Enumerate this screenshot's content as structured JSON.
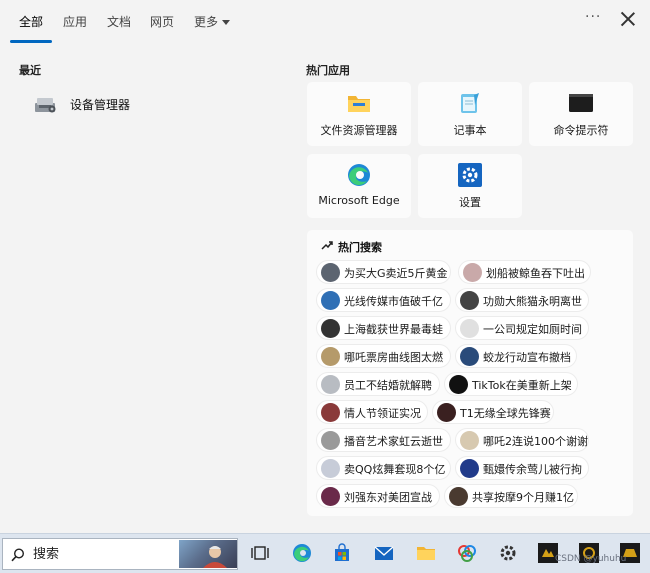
{
  "tabs": [
    {
      "label": "全部"
    },
    {
      "label": "应用"
    },
    {
      "label": "文档"
    },
    {
      "label": "网页"
    },
    {
      "label": "更多"
    }
  ],
  "header": {
    "more_options": "···"
  },
  "recent": {
    "title": "最近",
    "items": [
      {
        "label": "设备管理器",
        "icon": "device-manager-icon"
      }
    ]
  },
  "hot_apps": {
    "title": "热门应用",
    "items": [
      {
        "label": "文件资源管理器",
        "icon": "folder-icon"
      },
      {
        "label": "记事本",
        "icon": "notepad-icon"
      },
      {
        "label": "命令提示符",
        "icon": "command-prompt-icon"
      },
      {
        "label": "Microsoft Edge",
        "icon": "edge-icon"
      },
      {
        "label": "设置",
        "icon": "settings-gear-icon"
      }
    ]
  },
  "hot_search": {
    "title": "热门搜索",
    "items": [
      {
        "text": "为买大G卖近5斤黄金"
      },
      {
        "text": "划船被鲸鱼吞下吐出"
      },
      {
        "text": "光线传媒市值破千亿"
      },
      {
        "text": "功勋大熊猫永明离世"
      },
      {
        "text": "上海截获世界最毒蛙"
      },
      {
        "text": "一公司规定如厕时间"
      },
      {
        "text": "哪吒票房曲线图太燃"
      },
      {
        "text": "蛟龙行动宣布撤档"
      },
      {
        "text": "员工不结婚就解聘"
      },
      {
        "text": "TikTok在美重新上架"
      },
      {
        "text": "情人节领证实况"
      },
      {
        "text": "T1无缘全球先锋赛"
      },
      {
        "text": "播音艺术家虹云逝世"
      },
      {
        "text": "哪吒2连说100个谢谢"
      },
      {
        "text": "卖QQ炫舞套现8个亿"
      },
      {
        "text": "甄嬛传余莺儿被行拘"
      },
      {
        "text": "刘强东对美团宣战"
      },
      {
        "text": "共享按摩9个月赚1亿"
      }
    ]
  },
  "taskbar": {
    "search_placeholder": "搜索"
  },
  "watermark": "CSDN @yuhuhu"
}
